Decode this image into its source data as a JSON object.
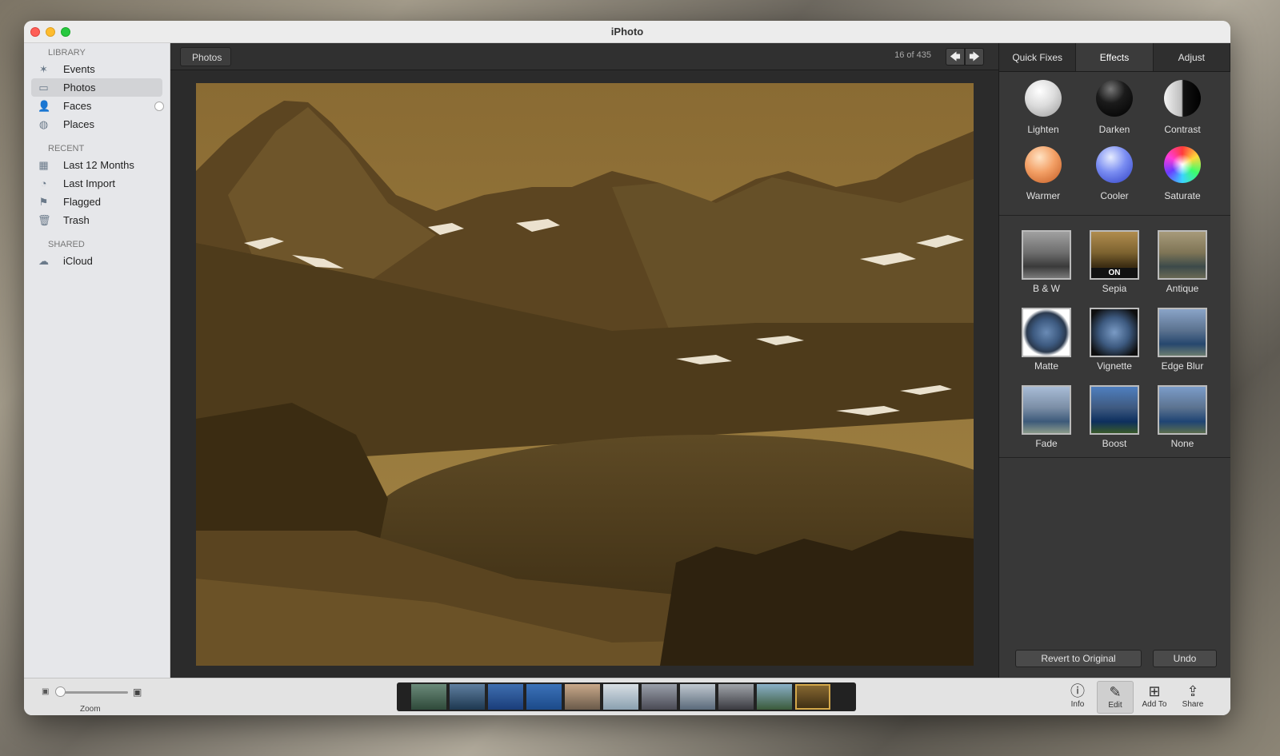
{
  "window": {
    "title": "iPhoto"
  },
  "sidebar": {
    "sections": [
      {
        "header": "LIBRARY",
        "items": [
          {
            "label": "Events",
            "icon": "palm-tree-icon"
          },
          {
            "label": "Photos",
            "icon": "photos-icon",
            "selected": true
          },
          {
            "label": "Faces",
            "icon": "person-icon"
          },
          {
            "label": "Places",
            "icon": "globe-icon"
          }
        ]
      },
      {
        "header": "RECENT",
        "items": [
          {
            "label": "Last 12 Months",
            "icon": "calendar-icon"
          },
          {
            "label": "Last Import",
            "icon": "clock-icon"
          },
          {
            "label": "Flagged",
            "icon": "flag-icon"
          },
          {
            "label": "Trash",
            "icon": "trash-icon"
          }
        ]
      },
      {
        "header": "SHARED",
        "items": [
          {
            "label": "iCloud",
            "icon": "cloud-icon"
          }
        ]
      }
    ]
  },
  "viewer": {
    "back_label": "Photos",
    "counter": "16 of 435",
    "prev_glyph": "🡄",
    "next_glyph": "🡆"
  },
  "panel": {
    "tabs": [
      {
        "label": "Quick Fixes",
        "active": false
      },
      {
        "label": "Effects",
        "active": true
      },
      {
        "label": "Adjust",
        "active": false
      }
    ],
    "quick_effects": [
      {
        "label": "Lighten"
      },
      {
        "label": "Darken"
      },
      {
        "label": "Contrast"
      },
      {
        "label": "Warmer"
      },
      {
        "label": "Cooler"
      },
      {
        "label": "Saturate"
      }
    ],
    "effects": [
      {
        "label": "B & W"
      },
      {
        "label": "Sepia",
        "badge": "ON"
      },
      {
        "label": "Antique"
      },
      {
        "label": "Matte"
      },
      {
        "label": "Vignette"
      },
      {
        "label": "Edge Blur"
      },
      {
        "label": "Fade"
      },
      {
        "label": "Boost"
      },
      {
        "label": "None"
      }
    ],
    "revert_label": "Revert to Original",
    "undo_label": "Undo"
  },
  "bottom": {
    "zoom_label": "Zoom",
    "zoom_level": 0.05,
    "filmstrip_count": 11,
    "filmstrip_selected_index": 10,
    "tools": [
      {
        "label": "Info",
        "icon": "info-icon",
        "glyph": "ⓘ",
        "active": false
      },
      {
        "label": "Edit",
        "icon": "pencil-icon",
        "glyph": "✎",
        "active": true
      },
      {
        "label": "Add To",
        "icon": "add-icon",
        "glyph": "⊞",
        "active": false
      },
      {
        "label": "Share",
        "icon": "share-icon",
        "glyph": "⇪",
        "active": false
      }
    ]
  },
  "colors": {
    "sepia_dark": "#3b2c12",
    "sepia_mid": "#7d6330",
    "sepia_light": "#a38545",
    "accent_gold": "#d4a84a"
  }
}
